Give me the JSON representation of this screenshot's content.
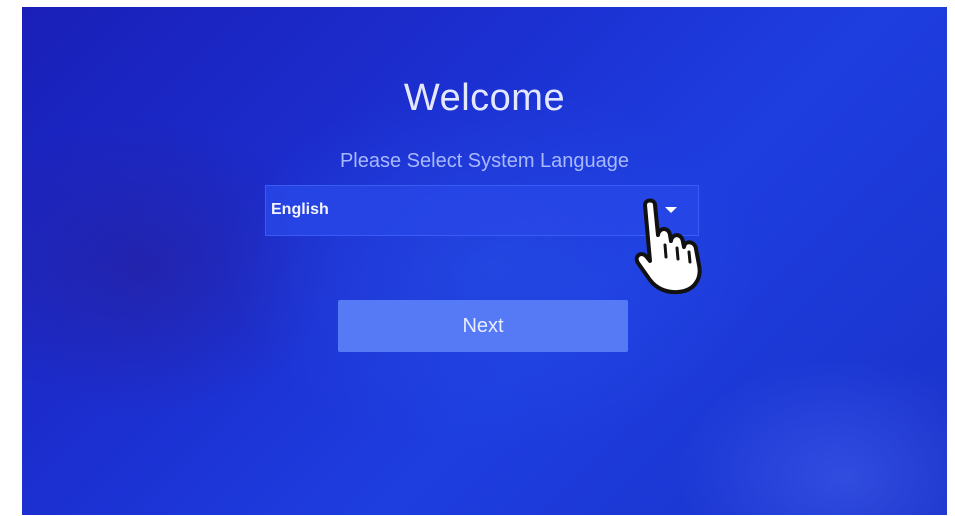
{
  "welcome": {
    "title": "Welcome",
    "subtitle": "Please Select System Language"
  },
  "language_select": {
    "selected_value": "English",
    "caret_icon": "chevron-down-icon"
  },
  "next_button": {
    "label": "Next"
  },
  "pointer": {
    "icon": "hand-pointer-icon"
  },
  "colors": {
    "background_primary": "#1c2fd0",
    "button": "#5679f5",
    "text_primary": "#e3e8ff",
    "text_secondary": "#a9b9ff"
  }
}
